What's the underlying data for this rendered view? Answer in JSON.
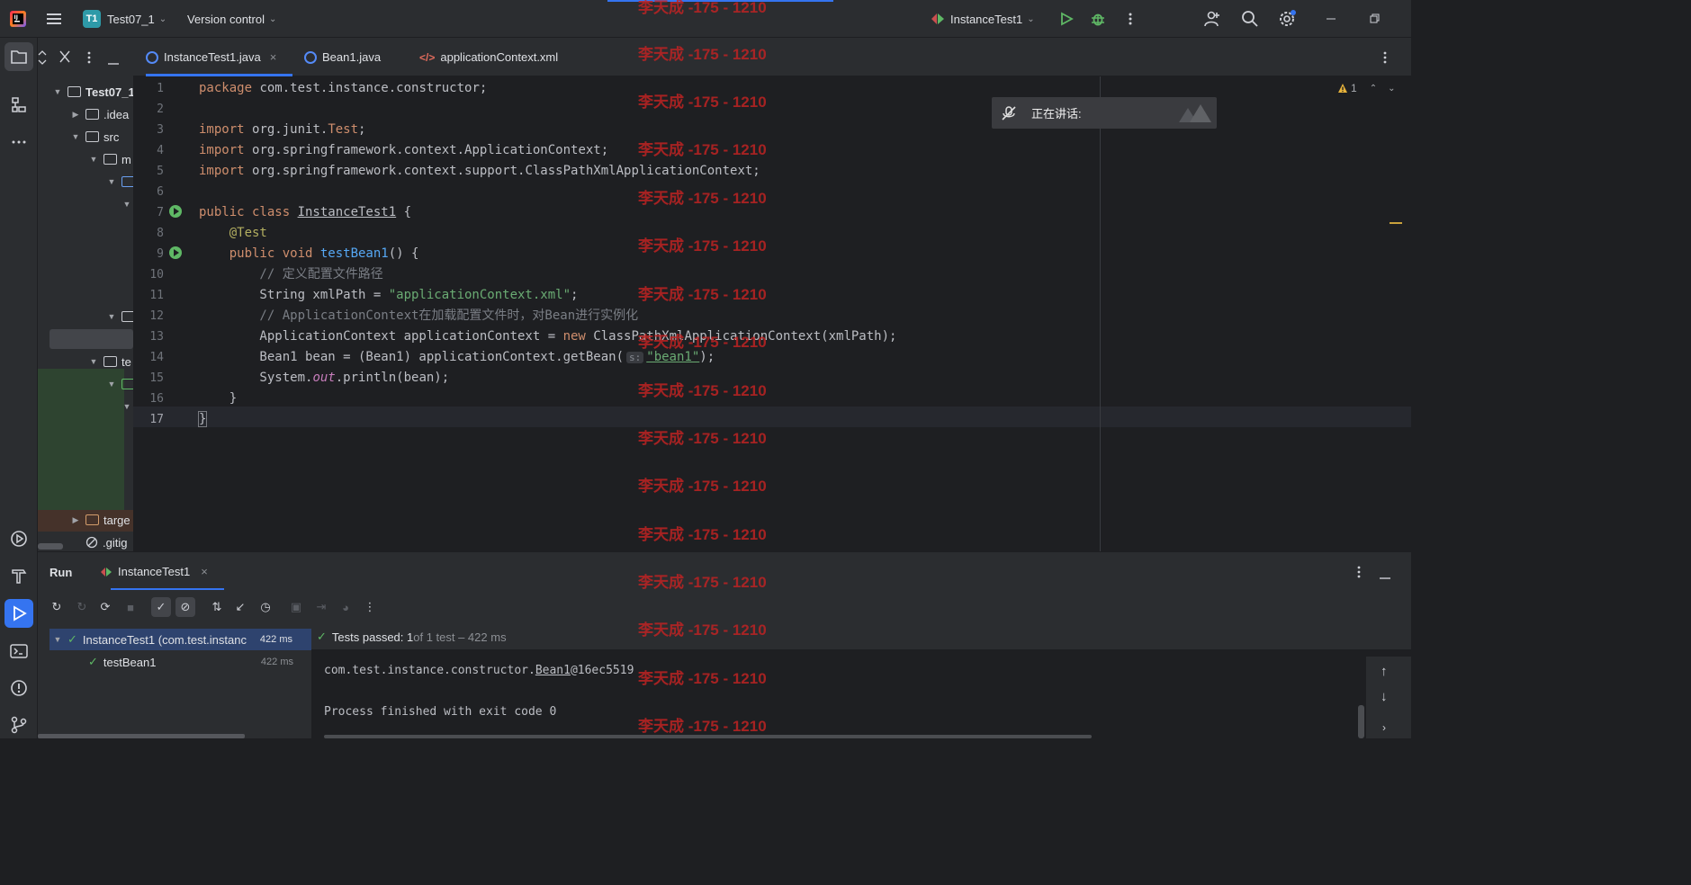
{
  "titlebar": {
    "project_badge": "T1",
    "project_name": "Test07_1",
    "vcs": "Version control",
    "run_config": "InstanceTest1"
  },
  "project_tree": {
    "root": "Test07_1",
    "items": [
      ".idea",
      "src",
      "m",
      "te",
      "targe",
      ".gitig"
    ]
  },
  "tabs": [
    {
      "label": "InstanceTest1.java",
      "active": true
    },
    {
      "label": "Bean1.java",
      "active": false
    },
    {
      "label": "applicationContext.xml",
      "active": false
    }
  ],
  "editor": {
    "warning_count": "1",
    "line_numbers": [
      "1",
      "2",
      "3",
      "4",
      "5",
      "6",
      "7",
      "8",
      "9",
      "10",
      "11",
      "12",
      "13",
      "14",
      "15",
      "16",
      "17"
    ],
    "lines": {
      "l1a": "package ",
      "l1b": "com.test.instance.constructor;",
      "l3a": "import ",
      "l3b": "org.junit.",
      "l3c": "Test",
      "l3d": ";",
      "l4a": "import ",
      "l4b": "org.springframework.context.ApplicationContext;",
      "l5a": "import ",
      "l5b": "org.springframework.context.support.ClassPathXmlApplicationContext;",
      "l7a": "public class ",
      "l7b": "InstanceTest1",
      "l7c": " {",
      "l8": "    @Test",
      "l9a": "    public void ",
      "l9b": "testBean1",
      "l9c": "() {",
      "l10": "        // 定义配置文件路径",
      "l11a": "        String xmlPath = ",
      "l11b": "\"applicationContext.xml\"",
      "l11c": ";",
      "l12": "        // ApplicationContext在加载配置文件时，对Bean进行实例化",
      "l13a": "        ApplicationContext applicationContext = ",
      "l13b": "new ",
      "l13c": "ClassPathXmlApplicationContext(xmlPath);",
      "l14a": "        Bean1 bean = (Bean1) applicationContext.getBean(",
      "l14hint": "s:",
      "l14b": "\"bean1\"",
      "l14c": ");",
      "l15a": "        System.",
      "l15b": "out",
      "l15c": ".println(bean);",
      "l16": "    }",
      "l17": "}"
    }
  },
  "watermark": "李天成 -175 - 1210",
  "talking_widget": {
    "label": "正在讲话:"
  },
  "run_panel": {
    "title": "Run",
    "tab": "InstanceTest1",
    "tree": [
      {
        "label": "InstanceTest1 (com.test.instanc",
        "time": "422 ms"
      },
      {
        "label": "testBean1",
        "time": "422 ms"
      }
    ],
    "status_bold": "Tests passed: 1",
    "status_rest": " of 1 test – 422 ms",
    "console": {
      "out_prefix": "com.test.instance.constructor.",
      "out_link": "Bean1",
      "out_suffix": "@16ec5519",
      "exit": "Process finished with exit code 0"
    }
  }
}
